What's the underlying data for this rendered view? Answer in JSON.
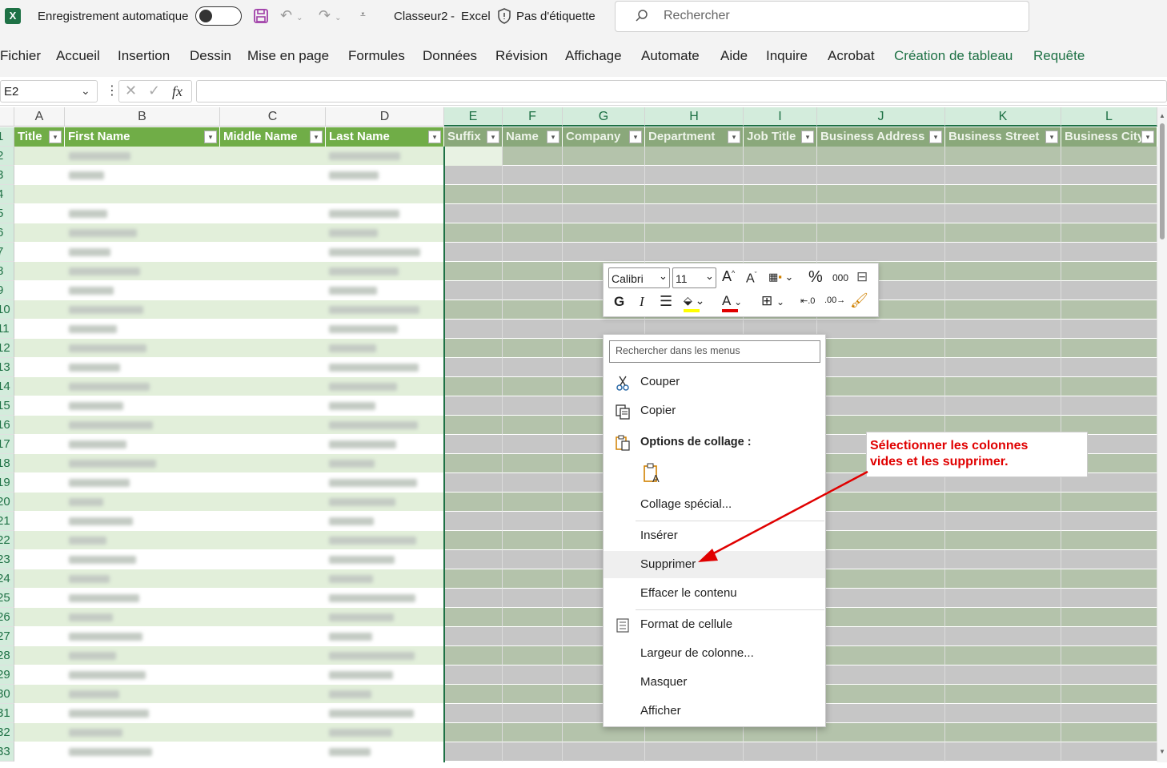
{
  "titlebar": {
    "autosave_label": "Enregistrement automatique",
    "filename": "Classeur2",
    "dash": "-",
    "app": "Excel",
    "label": "Pas d'étiquette",
    "search_placeholder": "Rechercher"
  },
  "ribbon_tabs": [
    "Fichier",
    "Accueil",
    "Insertion",
    "Dessin",
    "Mise en page",
    "Formules",
    "Données",
    "Révision",
    "Affichage",
    "Automate",
    "Aide",
    "Inquire",
    "Acrobat",
    "Création de tableau",
    "Requête"
  ],
  "formula_bar": {
    "name_box": "E2",
    "fx": "fx"
  },
  "columns": [
    "A",
    "B",
    "C",
    "D",
    "E",
    "F",
    "G",
    "H",
    "I",
    "J",
    "K",
    "L"
  ],
  "table_headers": [
    "Title",
    "First Name",
    "Middle Name",
    "Last Name",
    "Suffix",
    "Name",
    "Company",
    "Department",
    "Job Title",
    "Business Address",
    "Business Street",
    "Business City"
  ],
  "row_numbers": [
    "1",
    "2",
    "3",
    "4",
    "5",
    "6",
    "7",
    "8",
    "9",
    "10",
    "11",
    "12",
    "13",
    "14",
    "15",
    "16",
    "17",
    "18",
    "19",
    "20",
    "21",
    "22",
    "23",
    "24",
    "25",
    "26",
    "27",
    "28",
    "29",
    "30",
    "31",
    "32",
    "33"
  ],
  "mini_toolbar": {
    "font": "Calibri",
    "size": "11",
    "bold": "G",
    "italic": "I",
    "percent": "%",
    "thousands": "000"
  },
  "context_menu": {
    "search_placeholder": "Rechercher dans les menus",
    "items": {
      "cut": "Couper",
      "copy": "Copier",
      "paste_options": "Options de collage :",
      "paste_special": "Collage spécial...",
      "insert": "Insérer",
      "delete": "Supprimer",
      "clear": "Effacer le contenu",
      "format_cells": "Format de cellule",
      "col_width": "Largeur de colonne...",
      "hide": "Masquer",
      "unhide": "Afficher"
    }
  },
  "annotation": {
    "line1": "Sélectionner les colonnes",
    "line2": "vides et les supprimer."
  },
  "colors": {
    "excel_green": "#1e7145",
    "table_header": "#70ad47",
    "band_light": "#e2efda",
    "selection_gray": "#c6c6c6",
    "selection_green": "#b4c3ab",
    "annotation_red": "#e00000"
  }
}
